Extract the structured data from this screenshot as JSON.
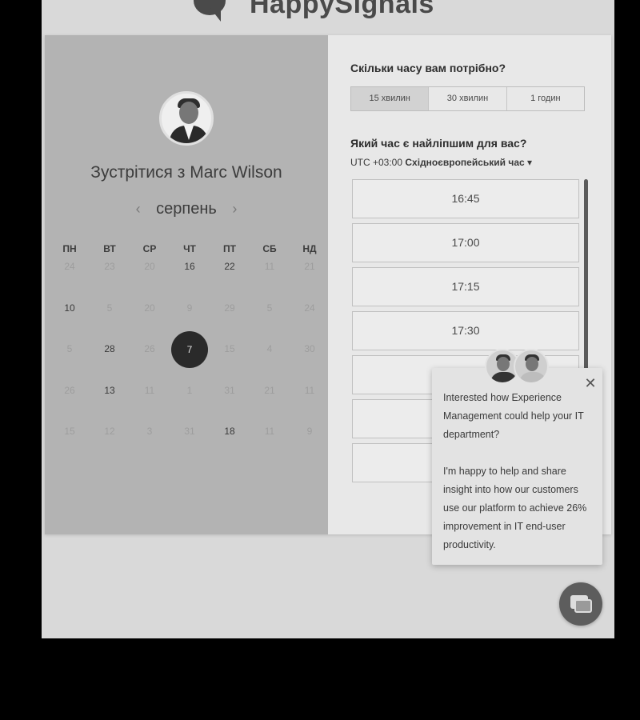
{
  "brand": {
    "name": "HappySignals"
  },
  "left": {
    "title": "Зустрітися з Marc Wilson",
    "month": "серпень",
    "prev_icon": "‹",
    "next_icon": "›",
    "weekdays": [
      "ПН",
      "ВТ",
      "СР",
      "ЧТ",
      "ПТ",
      "СБ",
      "НД"
    ],
    "weeks": [
      [
        {
          "d": "24",
          "s": "dim"
        },
        {
          "d": "23",
          "s": "dim"
        },
        {
          "d": "20",
          "s": "dim"
        },
        {
          "d": "16",
          "s": "on"
        },
        {
          "d": "22",
          "s": "on"
        },
        {
          "d": "11",
          "s": "dim"
        },
        {
          "d": "21",
          "s": "dim"
        }
      ],
      [
        {
          "d": "10",
          "s": "on"
        },
        {
          "d": "5",
          "s": "dim"
        },
        {
          "d": "20",
          "s": "dim"
        },
        {
          "d": "9",
          "s": "dim"
        },
        {
          "d": "29",
          "s": "dim"
        },
        {
          "d": "5",
          "s": "dim"
        },
        {
          "d": "24",
          "s": "dim"
        }
      ],
      [
        {
          "d": "5",
          "s": "dim"
        },
        {
          "d": "28",
          "s": "on"
        },
        {
          "d": "26",
          "s": "dim"
        },
        {
          "d": "7",
          "s": "sel"
        },
        {
          "d": "15",
          "s": "dim"
        },
        {
          "d": "4",
          "s": "dim"
        },
        {
          "d": "30",
          "s": "dim"
        }
      ],
      [
        {
          "d": "26",
          "s": "dim"
        },
        {
          "d": "13",
          "s": "on"
        },
        {
          "d": "11",
          "s": "dim"
        },
        {
          "d": "1",
          "s": "dim"
        },
        {
          "d": "31",
          "s": "dim"
        },
        {
          "d": "21",
          "s": "dim"
        },
        {
          "d": "11",
          "s": "dim"
        }
      ],
      [
        {
          "d": "15",
          "s": "dim"
        },
        {
          "d": "12",
          "s": "dim"
        },
        {
          "d": "3",
          "s": "dim"
        },
        {
          "d": "31",
          "s": "dim"
        },
        {
          "d": "18",
          "s": "on"
        },
        {
          "d": "11",
          "s": "dim"
        },
        {
          "d": "9",
          "s": "dim"
        }
      ]
    ]
  },
  "right": {
    "duration_question": "Скільки часу вам потрібно?",
    "durations": [
      "15 хвилин",
      "30 хвилин",
      "1 годин"
    ],
    "selected_duration": "15 хвилин",
    "time_question": "Який час є найліпшим для вас?",
    "tz_offset": "UTC +03:00",
    "tz_name": "Східноєвропейський час",
    "tz_caret": "▾",
    "slots": [
      "16:45",
      "17:00",
      "17:15",
      "17:30",
      "",
      "",
      ""
    ]
  },
  "popup": {
    "close_icon": "✕",
    "message": "Interested how Experience Management could help your IT department?\n\nI'm happy to help and share insight into how our customers use our platform to achieve 26% improvement in IT end-user productivity."
  },
  "chat": {
    "icon": "chat-bubbles-icon"
  }
}
